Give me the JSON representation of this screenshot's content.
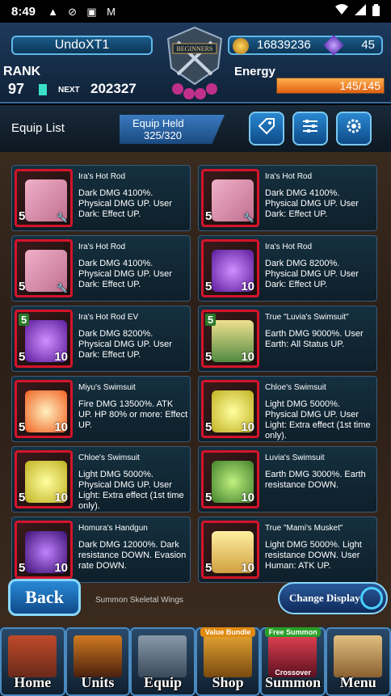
{
  "status_bar": {
    "time": "8:49",
    "icons": [
      "alert-icon",
      "no-sim-icon",
      "a-icon",
      "gmail-icon"
    ]
  },
  "header": {
    "player_name": "UndoXT1",
    "rank_label": "RANK",
    "rank_value": "97",
    "next_label": "NEXT",
    "next_value": "202327",
    "emblem_text": "BEGINNERS",
    "gold": "16839236",
    "gems": "45",
    "energy_label": "Energy",
    "energy_text": "145/145",
    "energy_fraction": 1.0
  },
  "equip_bar": {
    "title": "Equip List",
    "held_label": "Equip Held",
    "held_value": "325/320"
  },
  "cards": [
    {
      "name": "Ira's Hot Rod",
      "desc": "Dark DMG 4100%. Physical DMG UP. User Dark: Effect UP.",
      "plus": "5",
      "art": "car-pink"
    },
    {
      "name": "Ira's Hot Rod",
      "desc": "Dark DMG 4100%. Physical DMG UP. User Dark: Effect UP.",
      "plus": "5",
      "art": "car-pink"
    },
    {
      "name": "Ira's Hot Rod",
      "desc": "Dark DMG 4100%. Physical DMG UP. User Dark: Effect UP.",
      "plus": "5",
      "art": "car-pink"
    },
    {
      "name": "Ira's Hot Rod",
      "desc": "Dark DMG 8200%. Physical DMG UP. User Dark: Effect UP.",
      "plus": "5",
      "plus_r": "10",
      "art": "car-purple"
    },
    {
      "name": "Ira's Hot Rod EV",
      "desc": "Dark DMG 8200%. Physical DMG UP. User Dark: Effect UP.",
      "plus": "5",
      "plus_r": "10",
      "top_badge": "5",
      "art": "car-purple"
    },
    {
      "name": "True \"Luvia's Swimsuit\"",
      "desc": "Earth DMG 9000%. User Earth: All Status UP.",
      "plus": "5",
      "plus_r": "10",
      "top_badge": "5",
      "art": "girl-green"
    },
    {
      "name": "Miyu's Swimsuit",
      "desc": "Fire DMG 13500%. ATK UP. HP 80% or more: Effect UP.",
      "plus": "5",
      "plus_r": "10",
      "art": "fire"
    },
    {
      "name": "Chloe's Swimsuit",
      "desc": "Light DMG 5000%. Physical DMG UP. User Light: Extra effect (1st time only).",
      "plus": "5",
      "plus_r": "10",
      "art": "light"
    },
    {
      "name": "Chloe's Swimsuit",
      "desc": "Light DMG 5000%. Physical DMG UP. User Light: Extra effect (1st time only).",
      "plus": "5",
      "plus_r": "10",
      "art": "light"
    },
    {
      "name": "Luvia's Swimsuit",
      "desc": "Earth DMG 3000%. Earth resistance DOWN.",
      "plus": "5",
      "plus_r": "10",
      "art": "earth"
    },
    {
      "name": "Homura's Handgun",
      "desc": "Dark DMG 12000%. Dark resistance DOWN. Evasion rate DOWN.",
      "plus": "5",
      "plus_r": "10",
      "art": "dark-gun"
    },
    {
      "name": "True \"Mami's Musket\"",
      "desc": "Light DMG 5000%. Light resistance DOWN. User Human: ATK UP.",
      "plus": "5",
      "plus_r": "10",
      "art": "girl-light"
    }
  ],
  "partial_label": "Summon Skeletal Wings",
  "buttons": {
    "back": "Back",
    "change_display": "Change Display"
  },
  "nav": [
    {
      "label": "Home",
      "art": "home"
    },
    {
      "label": "Units",
      "art": "units"
    },
    {
      "label": "Equip",
      "art": "equip"
    },
    {
      "label": "Shop",
      "art": "shop",
      "tag": "Value Bundle"
    },
    {
      "label": "Summon",
      "art": "summon",
      "tag": "Free Summon",
      "tag2": "Crossover"
    },
    {
      "label": "Menu",
      "art": "menu"
    }
  ],
  "colors": {
    "frame_red": "#d4142a",
    "accent_blue": "#5fb8e8",
    "energy_orange": "#f07a20"
  }
}
